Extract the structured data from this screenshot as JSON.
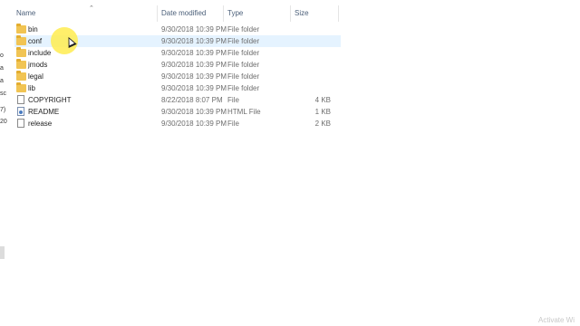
{
  "columns": {
    "name": "Name",
    "date_modified": "Date modified",
    "type": "Type",
    "size": "Size"
  },
  "nav_fragments": [
    "o",
    "a",
    "a",
    "sc",
    "7)",
    "20"
  ],
  "files": [
    {
      "name": "bin",
      "date": "9/30/2018 10:39 PM",
      "type": "File folder",
      "size": "",
      "icon": "folder-icon"
    },
    {
      "name": "conf",
      "date": "9/30/2018 10:39 PM",
      "type": "File folder",
      "size": "",
      "icon": "folder-icon"
    },
    {
      "name": "include",
      "date": "9/30/2018 10:39 PM",
      "type": "File folder",
      "size": "",
      "icon": "folder-icon"
    },
    {
      "name": "jmods",
      "date": "9/30/2018 10:39 PM",
      "type": "File folder",
      "size": "",
      "icon": "folder-icon"
    },
    {
      "name": "legal",
      "date": "9/30/2018 10:39 PM",
      "type": "File folder",
      "size": "",
      "icon": "folder-icon"
    },
    {
      "name": "lib",
      "date": "9/30/2018 10:39 PM",
      "type": "File folder",
      "size": "",
      "icon": "folder-icon"
    },
    {
      "name": "COPYRIGHT",
      "date": "8/22/2018 8:07 PM",
      "type": "File",
      "size": "4 KB",
      "icon": "file-icon"
    },
    {
      "name": "README",
      "date": "9/30/2018 10:39 PM",
      "type": "HTML File",
      "size": "1 KB",
      "icon": "html-file-icon"
    },
    {
      "name": "release",
      "date": "9/30/2018 10:39 PM",
      "type": "File",
      "size": "2 KB",
      "icon": "file-icon"
    }
  ],
  "watermark": "Activate Wi"
}
